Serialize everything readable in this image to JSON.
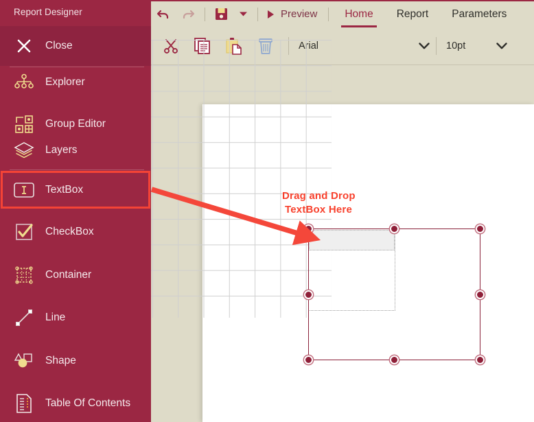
{
  "sidebar": {
    "title": "Report Designer",
    "items": [
      {
        "label": "Close",
        "icon": "close-x-icon"
      },
      {
        "label": "Explorer",
        "icon": "explorer-tree-icon"
      },
      {
        "label": "Group Editor",
        "icon": "group-editor-icon"
      },
      {
        "label": "Layers",
        "icon": "layers-stack-icon"
      },
      {
        "label": "TextBox",
        "icon": "textbox-icon"
      },
      {
        "label": "CheckBox",
        "icon": "checkbox-checked-icon"
      },
      {
        "label": "Container",
        "icon": "container-grid-icon"
      },
      {
        "label": "Line",
        "icon": "line-diagonal-icon"
      },
      {
        "label": "Shape",
        "icon": "shape-circle-icon"
      },
      {
        "label": "Table Of Contents",
        "icon": "table-of-contents-icon"
      }
    ],
    "highlighted_item": "TextBox",
    "colors": {
      "background": "#9b2743",
      "hover_background": "#8e2340",
      "icon": "#f0dc8e",
      "highlight_outline": "#f44336"
    }
  },
  "ribbon": {
    "quick_access": [
      {
        "name": "undo-button",
        "icon": "undo-arrow-icon",
        "state": "enabled"
      },
      {
        "name": "redo-button",
        "icon": "redo-arrow-icon",
        "state": "disabled"
      },
      {
        "name": "save-button",
        "icon": "floppy-save-icon",
        "state": "enabled"
      },
      {
        "name": "save-dropdown-button",
        "icon": "chevron-down-icon",
        "state": "enabled"
      }
    ],
    "preview_label": "Preview",
    "tabs": [
      {
        "label": "Home",
        "active": true
      },
      {
        "label": "Report",
        "active": false
      },
      {
        "label": "Parameters",
        "active": false
      }
    ],
    "clipboard_tools": [
      {
        "name": "cut-button",
        "icon": "scissors-icon"
      },
      {
        "name": "copy-button",
        "icon": "copy-documents-icon"
      },
      {
        "name": "paste-button",
        "icon": "clipboard-paste-icon"
      },
      {
        "name": "delete-button",
        "icon": "trash-can-icon"
      }
    ],
    "font_family": "Arial",
    "font_size": "10pt",
    "colors": {
      "background": "#dedbc8",
      "accent": "#9b2743",
      "active_tab_text": "#9b2743"
    }
  },
  "canvas": {
    "drop_hint_line1": "Drag and Drop",
    "drop_hint_line2": "TextBox Here",
    "drop_hint_color": "#f8402c",
    "selection": {
      "handle_color": "#8f2039",
      "border_color": "#8a2139",
      "handles": 8
    },
    "ghost_drop_preview": {
      "fill": "#efefef",
      "border": "dotted"
    },
    "grid_visible": true,
    "grid_color": "#cfcfcf",
    "page_background": "#ffffff"
  },
  "annotation": {
    "arrow_color": "#f4473a",
    "from": "TextBox sidebar item",
    "to": "drop target on report canvas"
  }
}
